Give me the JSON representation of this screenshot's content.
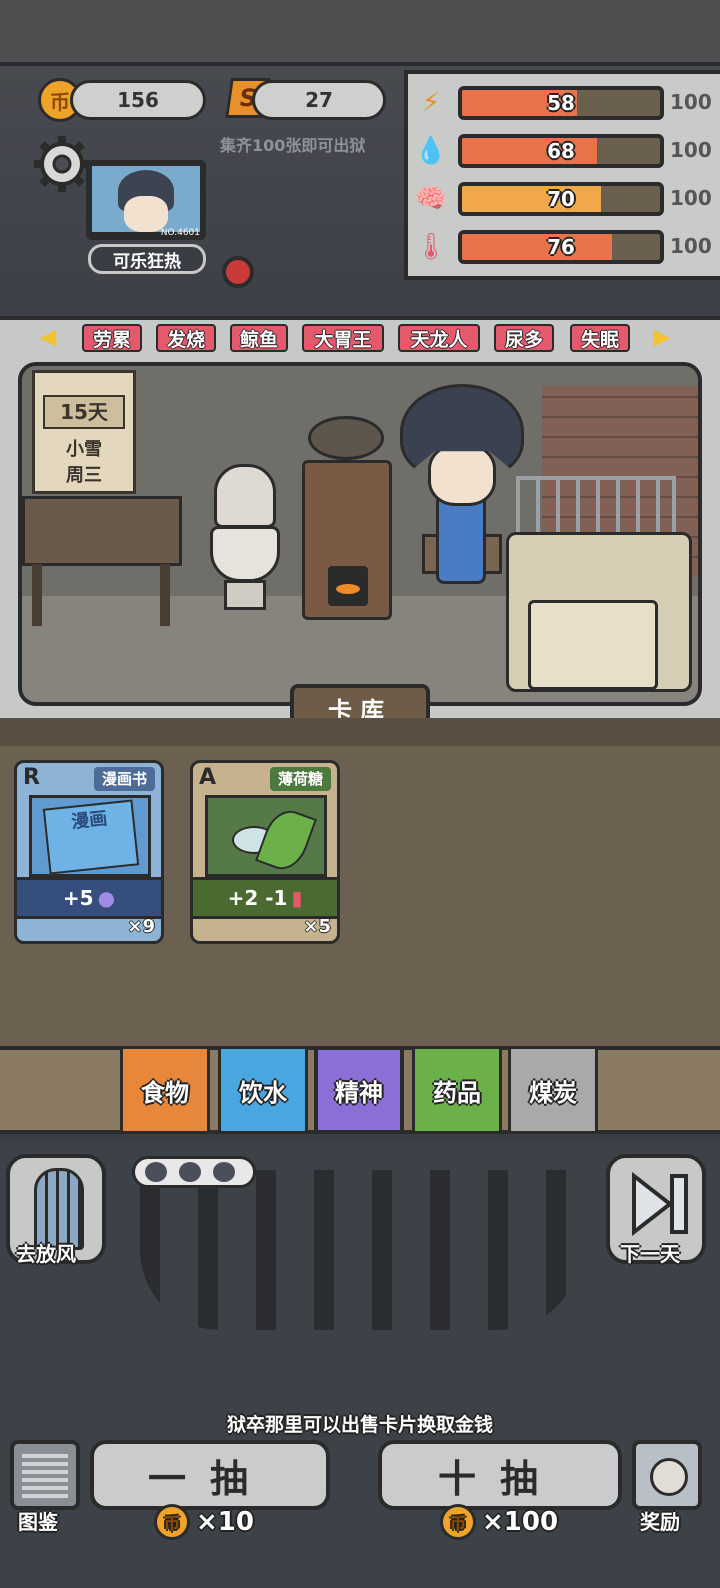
{
  "currency": {
    "coins": "156",
    "special": "27",
    "special_icon": "S",
    "coin_icon": "币",
    "hint": "集齐100张即可出狱"
  },
  "prisoner": {
    "name": "可乐狂热",
    "number": "NO.4601"
  },
  "stats": [
    {
      "icon": "energy-icon",
      "glyph": "⚡",
      "value": "58",
      "max": "100",
      "level": 0.58,
      "color": "#e8734a"
    },
    {
      "icon": "water-icon",
      "glyph": "💧",
      "value": "68",
      "max": "100",
      "level": 0.68,
      "color": "#e8734a"
    },
    {
      "icon": "brain-icon",
      "glyph": "🧠",
      "value": "70",
      "max": "100",
      "level": 0.7,
      "color": "#f0a84a"
    },
    {
      "icon": "temperature-icon",
      "glyph": "🌡",
      "value": "76",
      "max": "100",
      "level": 0.76,
      "color": "#e8734a"
    }
  ],
  "traits": [
    "劳累",
    "发烧",
    "鲸鱼",
    "大胃王",
    "天龙人",
    "尿多",
    "失眠"
  ],
  "calendar": {
    "day": "15天",
    "weather": "小雪",
    "weekday": "周三"
  },
  "card_library_label": "卡库",
  "cards": [
    {
      "rarity": "R",
      "name": "漫画书",
      "art_text": "漫画",
      "effect": "+5",
      "count": "×9"
    },
    {
      "rarity": "A",
      "name": "薄荷糖",
      "effect": "+2 -1",
      "count": "×5"
    }
  ],
  "categories": [
    {
      "label": "食物",
      "color": "#e8873a"
    },
    {
      "label": "饮水",
      "color": "#4aa6df"
    },
    {
      "label": "精神",
      "color": "#8b6fd6"
    },
    {
      "label": "药品",
      "color": "#6cb04a"
    },
    {
      "label": "煤炭",
      "color": "#a9a9a9"
    }
  ],
  "actions": {
    "yard": "去放风",
    "next_day": "下一天",
    "album": "图鉴",
    "reward": "奖励"
  },
  "tip": "狱卒那里可以出售卡片换取金钱",
  "draws": [
    {
      "label": "一抽",
      "cost": "×10"
    },
    {
      "label": "十抽",
      "cost": "×100"
    }
  ]
}
